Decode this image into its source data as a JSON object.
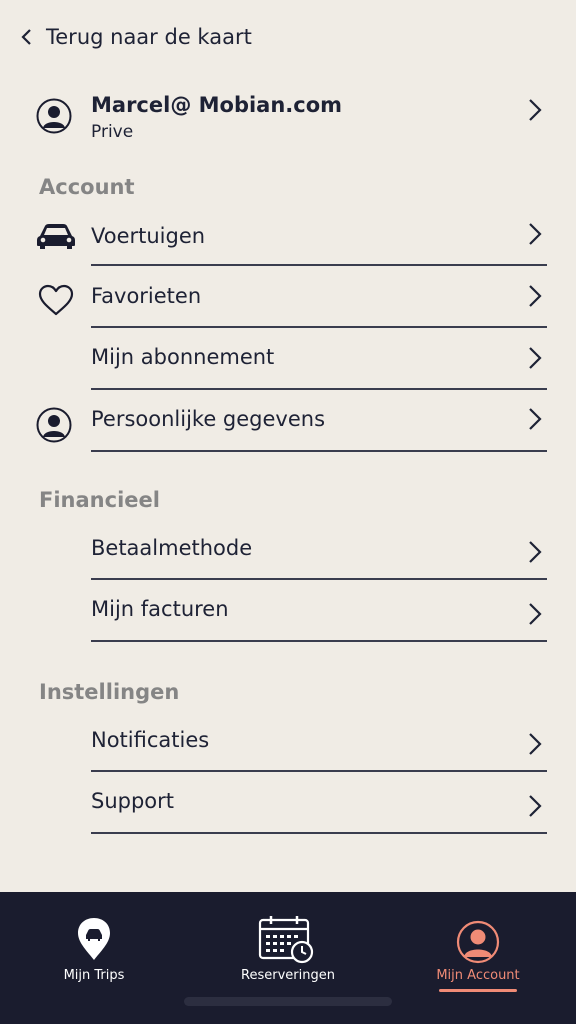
{
  "back": {
    "label": "Terug naar de kaart"
  },
  "profile": {
    "name": "Marcel@ Mobian.com",
    "type": "Prive"
  },
  "sections": {
    "account": "Account",
    "financieel": "Financieel",
    "instellingen": "Instellingen"
  },
  "items": {
    "voertuigen": "Voertuigen",
    "favorieten": "Favorieten",
    "abonnement": "Mijn abonnement",
    "persoonlijk": "Persoonlijke gegevens",
    "betaalmethode": "Betaalmethode",
    "facturen": "Mijn facturen",
    "notificaties": "Notificaties",
    "support": "Support"
  },
  "nav": {
    "trips": "Mijn Trips",
    "reserveringen": "Reserveringen",
    "account": "Mijn Account"
  },
  "colors": {
    "background": "#f0ece5",
    "navbar": "#1a1c2e",
    "accent": "#f08b76",
    "section_title": "#858585"
  },
  "icons": {
    "back": "chevron-left-icon",
    "profile": "user-circle-icon",
    "vehicle": "car-icon",
    "favorite": "heart-icon",
    "trips": "map-pin-car-icon",
    "reservations": "calendar-clock-icon",
    "account": "user-circle-icon"
  }
}
